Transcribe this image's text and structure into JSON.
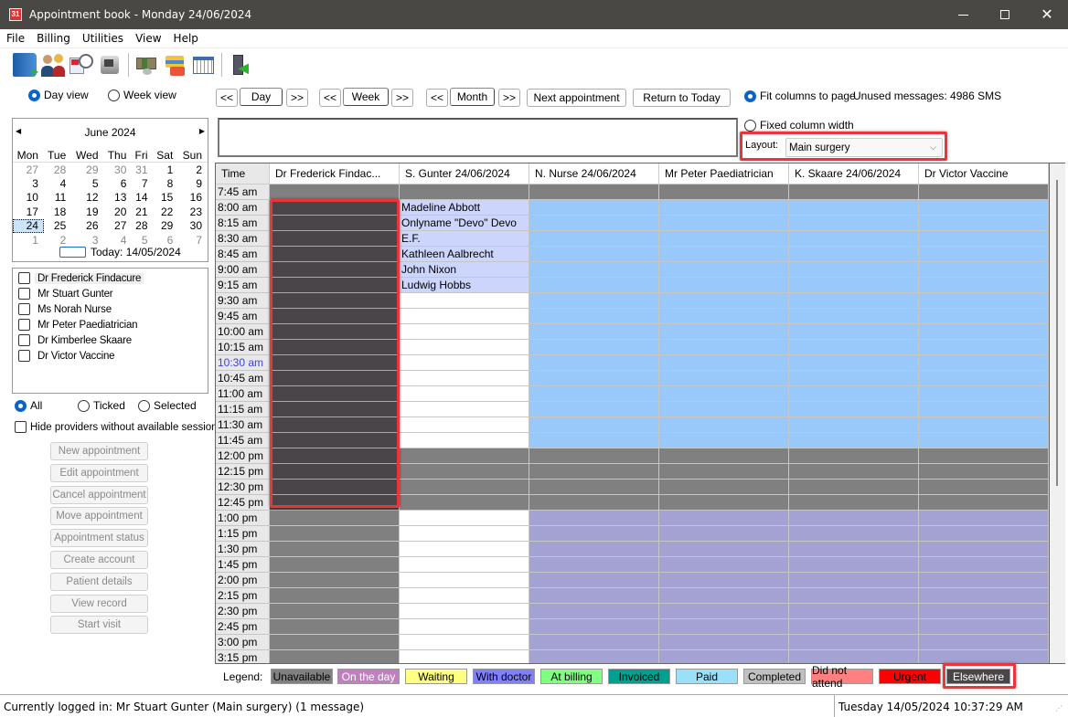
{
  "window": {
    "title": "Appointment book - Monday 24/06/2024"
  },
  "menu": [
    "File",
    "Billing",
    "Utilities",
    "View",
    "Help"
  ],
  "toolbar": {
    "icons": [
      "new-patient-icon",
      "patients-icon",
      "appointment-clock-icon",
      "printer-icon",
      "money-icon",
      "cards-icon",
      "calendar-grid-icon",
      "exit-door-icon"
    ]
  },
  "view": {
    "day_view": "Day view",
    "week_view": "Week view",
    "selected": "day"
  },
  "nav": {
    "prev": "<<",
    "next": ">>",
    "day": "Day",
    "week": "Week",
    "month": "Month",
    "next_appointment": "Next appointment",
    "return_today": "Return to Today"
  },
  "options": {
    "fit_columns": "Fit columns to page",
    "fixed_width": "Fixed column width",
    "unused_messages": "Unused messages: 4986 SMS",
    "layout_label": "Layout:",
    "layout_value": "Main surgery"
  },
  "calendar": {
    "month_label": "June 2024",
    "weekdays": [
      "Mon",
      "Tue",
      "Wed",
      "Thu",
      "Fri",
      "Sat",
      "Sun"
    ],
    "weeks": [
      [
        [
          "27",
          1
        ],
        [
          "28",
          1
        ],
        [
          "29",
          1
        ],
        [
          "30",
          1
        ],
        [
          "31",
          1
        ],
        [
          "1",
          0
        ],
        [
          "2",
          0
        ]
      ],
      [
        [
          "3",
          0
        ],
        [
          "4",
          0
        ],
        [
          "5",
          0
        ],
        [
          "6",
          0
        ],
        [
          "7",
          0
        ],
        [
          "8",
          0
        ],
        [
          "9",
          0
        ]
      ],
      [
        [
          "10",
          0
        ],
        [
          "11",
          0
        ],
        [
          "12",
          0
        ],
        [
          "13",
          0
        ],
        [
          "14",
          0
        ],
        [
          "15",
          0
        ],
        [
          "16",
          0
        ]
      ],
      [
        [
          "17",
          0
        ],
        [
          "18",
          0
        ],
        [
          "19",
          0
        ],
        [
          "20",
          0
        ],
        [
          "21",
          0
        ],
        [
          "22",
          0
        ],
        [
          "23",
          0
        ]
      ],
      [
        [
          "24",
          2
        ],
        [
          "25",
          0
        ],
        [
          "26",
          0
        ],
        [
          "27",
          0
        ],
        [
          "28",
          0
        ],
        [
          "29",
          0
        ],
        [
          "30",
          0
        ]
      ],
      [
        [
          "1",
          1
        ],
        [
          "2",
          1
        ],
        [
          "3",
          1
        ],
        [
          "4",
          1
        ],
        [
          "5",
          1
        ],
        [
          "6",
          1
        ],
        [
          "7",
          1
        ]
      ]
    ],
    "today_label": "Today: 14/05/2024"
  },
  "providers": [
    {
      "name": "Dr Frederick Findacure",
      "checked": false
    },
    {
      "name": "Mr Stuart Gunter",
      "checked": false
    },
    {
      "name": "Ms Norah Nurse",
      "checked": false
    },
    {
      "name": "Mr Peter Paediatrician",
      "checked": false
    },
    {
      "name": "Dr Kimberlee Skaare",
      "checked": false
    },
    {
      "name": "Dr Victor Vaccine",
      "checked": false
    }
  ],
  "filter": {
    "all": "All",
    "ticked": "Ticked",
    "selected": "Selected",
    "hide_label": "Hide providers without available sessions"
  },
  "actions": [
    "New appointment",
    "Edit appointment",
    "Cancel appointment",
    "Move appointment",
    "Appointment status",
    "Create account",
    "Patient details",
    "View record",
    "Start visit"
  ],
  "grid": {
    "headers": [
      "Time",
      "Dr Frederick Findac...",
      "S. Gunter  24/06/2024",
      "N. Nurse  24/06/2024",
      "Mr Peter Paediatrician",
      "K. Skaare  24/06/2024",
      "Dr Victor Vaccine"
    ],
    "current_time": "10:30 am",
    "times": [
      "7:45 am",
      "8:00 am",
      "8:15 am",
      "8:30 am",
      "8:45 am",
      "9:00 am",
      "9:15 am",
      "9:30 am",
      "9:45 am",
      "10:00 am",
      "10:15 am",
      "10:30 am",
      "10:45 am",
      "11:00 am",
      "11:15 am",
      "11:30 am",
      "11:45 am",
      "12:00 pm",
      "12:15 pm",
      "12:30 pm",
      "12:45 pm",
      "1:00 pm",
      "1:15 pm",
      "1:30 pm",
      "1:45 pm",
      "2:00 pm",
      "2:15 pm",
      "2:30 pm",
      "2:45 pm",
      "3:00 pm",
      "3:15 pm"
    ],
    "appointments": [
      {
        "time": "8:00 am",
        "provider": "S. Gunter",
        "patient": "Madeline Abbott"
      },
      {
        "time": "8:15 am",
        "provider": "S. Gunter",
        "patient": "Onlyname \"Devo\" Devo"
      },
      {
        "time": "8:30 am",
        "provider": "S. Gunter",
        "patient": "E.F."
      },
      {
        "time": "8:45 am",
        "provider": "S. Gunter",
        "patient": "Kathleen Aalbrecht"
      },
      {
        "time": "9:00 am",
        "provider": "S. Gunter",
        "patient": "John Nixon"
      },
      {
        "time": "9:15 am",
        "provider": "S. Gunter",
        "patient": "Ludwig Hobbs"
      }
    ]
  },
  "legend": {
    "label": "Legend:",
    "items": [
      {
        "label": "Unavailable",
        "bg": "#808080",
        "fg": "#000000"
      },
      {
        "label": "On the day",
        "bg": "#c080c0",
        "fg": "#ffffff"
      },
      {
        "label": "Waiting",
        "bg": "#ffff80",
        "fg": "#000000"
      },
      {
        "label": "With doctor",
        "bg": "#8080ff",
        "fg": "#000000"
      },
      {
        "label": "At billing",
        "bg": "#80ff80",
        "fg": "#000000"
      },
      {
        "label": "Invoiced",
        "bg": "#00a090",
        "fg": "#000000"
      },
      {
        "label": "Paid",
        "bg": "#99e0f8",
        "fg": "#000000"
      },
      {
        "label": "Completed",
        "bg": "#c0c0c0",
        "fg": "#000000"
      },
      {
        "label": "Did not attend",
        "bg": "#ff8080",
        "fg": "#000000"
      },
      {
        "label": "Urgent",
        "bg": "#ff0000",
        "fg": "#000000"
      },
      {
        "label": "Elsewhere",
        "bg": "#4a4548",
        "fg": "#ffffff"
      }
    ]
  },
  "colors": {
    "unavailable": "#808080",
    "elsewhere": "#4a4548",
    "available_blue": "#99c9fb",
    "available_purple": "#a3a2d2",
    "booked": "#ccd5fb",
    "highlight": "#e8363a"
  },
  "status": {
    "logged_in": "Currently logged in:  Mr Stuart Gunter (Main surgery) (1 message)",
    "datetime": "Tuesday 14/05/2024 10:37:29 AM"
  }
}
